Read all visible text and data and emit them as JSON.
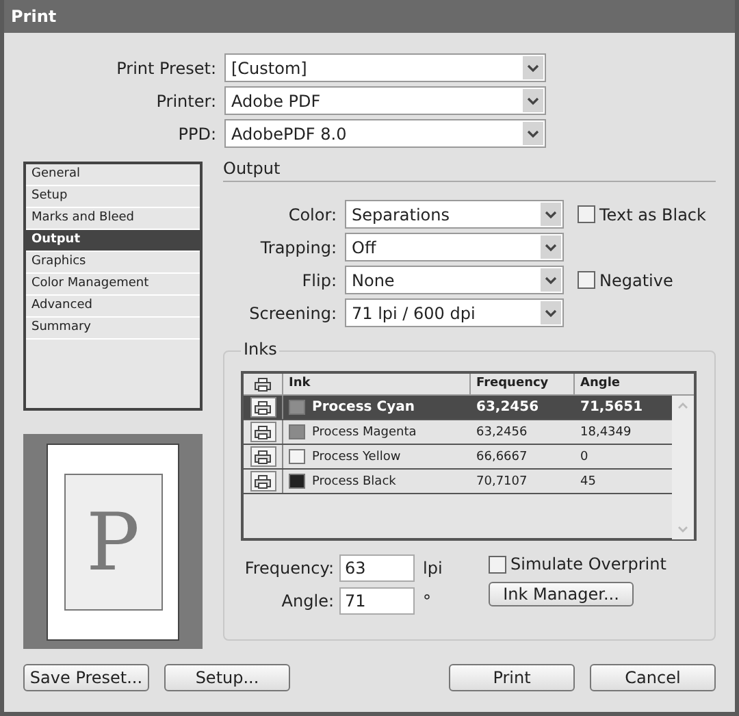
{
  "window": {
    "title": "Print"
  },
  "top_fields": [
    {
      "label": "Print Preset:",
      "value": "[Custom]"
    },
    {
      "label": "Printer:",
      "value": "Adobe PDF"
    },
    {
      "label": "PPD:",
      "value": "AdobePDF 8.0"
    }
  ],
  "sidebar": {
    "items": [
      {
        "label": "General",
        "selected": false
      },
      {
        "label": "Setup",
        "selected": false
      },
      {
        "label": "Marks and Bleed",
        "selected": false
      },
      {
        "label": "Output",
        "selected": true
      },
      {
        "label": "Graphics",
        "selected": false
      },
      {
        "label": "Color Management",
        "selected": false
      },
      {
        "label": "Advanced",
        "selected": false
      },
      {
        "label": "Summary",
        "selected": false
      }
    ]
  },
  "preview": {
    "letter": "P"
  },
  "section_title": "Output",
  "output_fields": [
    {
      "label": "Color:",
      "value": "Separations",
      "checkbox": {
        "label": "Text as Black",
        "checked": false
      }
    },
    {
      "label": "Trapping:",
      "value": "Off"
    },
    {
      "label": "Flip:",
      "value": "None",
      "checkbox": {
        "label": "Negative",
        "checked": false
      }
    },
    {
      "label": "Screening:",
      "value": "71 lpi / 600 dpi"
    }
  ],
  "inks": {
    "title": "Inks",
    "columns": [
      "Ink",
      "Frequency",
      "Angle"
    ],
    "rows": [
      {
        "name": "Process Cyan",
        "frequency": "63,2456",
        "angle": "71,5651",
        "color": "#8c8c8c",
        "selected": true
      },
      {
        "name": "Process Magenta",
        "frequency": "63,2456",
        "angle": "18,4349",
        "color": "#8a8a8a",
        "selected": false
      },
      {
        "name": "Process Yellow",
        "frequency": "66,6667",
        "angle": "0",
        "color": "#f4f4f4",
        "selected": false
      },
      {
        "name": "Process Black",
        "frequency": "70,7107",
        "angle": "45",
        "color": "#222222",
        "selected": false
      }
    ],
    "frequency": {
      "label": "Frequency:",
      "value": "63",
      "unit": "lpi"
    },
    "angle": {
      "label": "Angle:",
      "value": "71",
      "unit": "°"
    },
    "simulate_overprint": {
      "label": "Simulate Overprint",
      "checked": false
    },
    "ink_manager_button": "Ink Manager..."
  },
  "buttons_left": [
    "Save Preset...",
    "Setup..."
  ],
  "buttons_right": [
    "Print",
    "Cancel"
  ]
}
